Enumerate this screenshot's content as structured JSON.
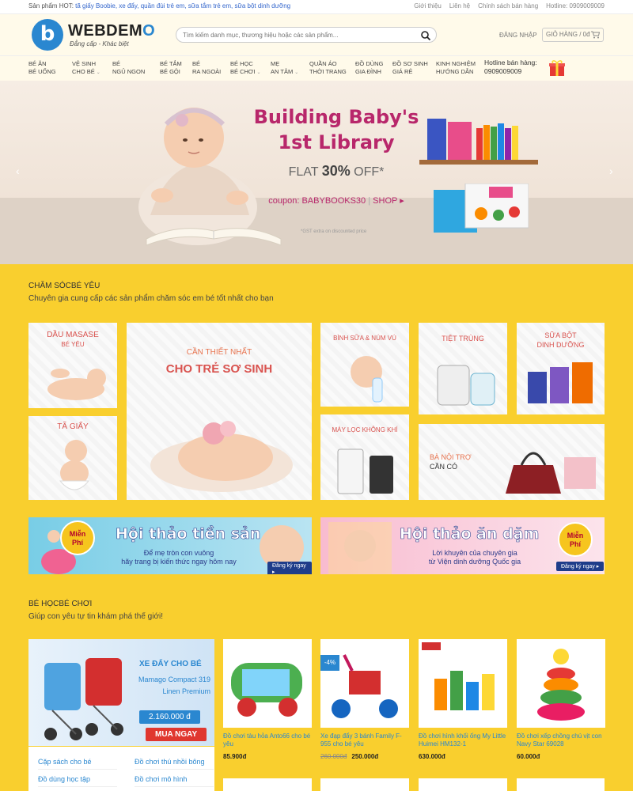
{
  "topbar": {
    "hot_label": "Sản phẩm HOT:",
    "hot_links": "tã giấy Boobie, xe đẩy, quần đùi trẻ em, sữa tắm trẻ em, sữa bột dinh dưỡng",
    "links": [
      "Giới thiệu",
      "Liên hệ",
      "Chính sách bán hàng",
      "Hotline: 0909009009"
    ]
  },
  "header": {
    "logo_letter": "b",
    "brand": "WEBDEM",
    "brand_o": "O",
    "slogan": "Đẳng cấp - Khác biệt",
    "search_placeholder": "Tìm kiếm danh mục, thương hiệu hoặc các sản phẩm...",
    "login": "ĐĂNG NHẬP",
    "cart": "GIỎ HÀNG / 0đ"
  },
  "nav": {
    "items": [
      {
        "l1": "Bé ăn",
        "l2": "Bé uống"
      },
      {
        "l1": "Vệ sinh",
        "l2": "cho bé"
      },
      {
        "l1": "Bé",
        "l2": "ngủ ngon"
      },
      {
        "l1": "Bé tắm",
        "l2": "Bé gội"
      },
      {
        "l1": "Bé",
        "l2": "ra ngoài"
      },
      {
        "l1": "Bé học",
        "l2": "Bé chơi"
      },
      {
        "l1": "Mẹ",
        "l2": "an tâm"
      },
      {
        "l1": "Quần áo",
        "l2": "thời trang"
      },
      {
        "l1": "Đồ dùng",
        "l2": "gia đình"
      },
      {
        "l1": "Đồ sơ sinh",
        "l2": "giá rẻ"
      },
      {
        "l1": "Kinh nghiệm",
        "l2": "hướng dẫn"
      }
    ],
    "hotline_label": "Hotline bán hàng:",
    "hotline_number": "0909009009"
  },
  "hero": {
    "title_line1": "Building Baby's",
    "title_line2": "1st Library",
    "flat": "FLAT",
    "percent": "30%",
    "off": "OFF*",
    "coupon": "coupon: BABYBOOKS30",
    "shop": "SHOP ▸",
    "gst": "*GST extra on discounted price"
  },
  "section1": {
    "title": "CHĂM SÓCBÉ YÊU",
    "subtitle": "Chuyên gia cung cấp các sản phẩm chăm sóc em bé tốt nhất cho bạn",
    "cards": {
      "massage_1": "DẦU MASASE",
      "massage_2": "BÉ YÊU",
      "diaper": "TÃ GIẤY",
      "newborn_1": "CẦN THIẾT NHẤT",
      "newborn_2": "CHO TRẺ SƠ SINH",
      "bottle": "BÌNH SỮA & NÚM VÚ",
      "sterilize": "TIỆT TRÙNG",
      "milk_1": "SỮA BỘT",
      "milk_2": "DINH DƯỠNG",
      "air": "MÁY LỌC KHÔNG KHÍ",
      "housewife_1": "BÀ NỘI TRỢ",
      "housewife_2": "CẦN CÓ"
    }
  },
  "banners": {
    "b1_title": "Hội thảo tiền sản",
    "b1_sub1": "Để mẹ tròn con vuông",
    "b1_sub2": "hãy trang bị kiến thức ngay hôm nay",
    "b1_btn": "Đăng ký ngay ▸",
    "b2_title": "Hội thảo ăn dặm",
    "b2_sub1": "Lời khuyên của chuyên gia",
    "b2_sub2": "từ Viện dinh dưỡng Quốc gia",
    "b2_btn": "Đăng ký ngay ▸",
    "badge_1": "Miễn",
    "badge_2": "Phí"
  },
  "section2": {
    "title": "BÉ HỌCBÉ CHƠI",
    "subtitle": "Giúp con yêu tự tin khám phá thế giới!",
    "promo": {
      "title": "XE ĐẨY CHO BÉ",
      "name_1": "Mamago Compact 319",
      "name_2": "Linen Premium",
      "price": "2.160.000 đ",
      "button": "MUA NGAY"
    },
    "categories": [
      "Cặp sách cho bé",
      "Đồ chơi thú nhồi bông",
      "Đồ dùng học tập",
      "Đồ chơi mô hình"
    ],
    "products": [
      {
        "name": "Đồ chơi tàu hỏa Anto66 cho bé yêu",
        "old": "",
        "price": "85.900đ"
      },
      {
        "name": "Xe đạp đẩy 3 bánh Family F-955 cho bé yêu",
        "old": "260.000đ",
        "price": "250.000đ",
        "sale": "-4%"
      },
      {
        "name": "Đồ chơi hình khối ống My Little Huimei HM132-1",
        "old": "",
        "price": "630.000đ"
      },
      {
        "name": "Đồ chơi xếp chồng chú vịt con Navy Star 69028",
        "old": "",
        "price": "60.000đ"
      }
    ]
  },
  "colors": {
    "accent": "#2a87d0",
    "section_bg": "#f9cf2e",
    "hero_title": "#b8276b",
    "card_caption": "#d9534f"
  }
}
